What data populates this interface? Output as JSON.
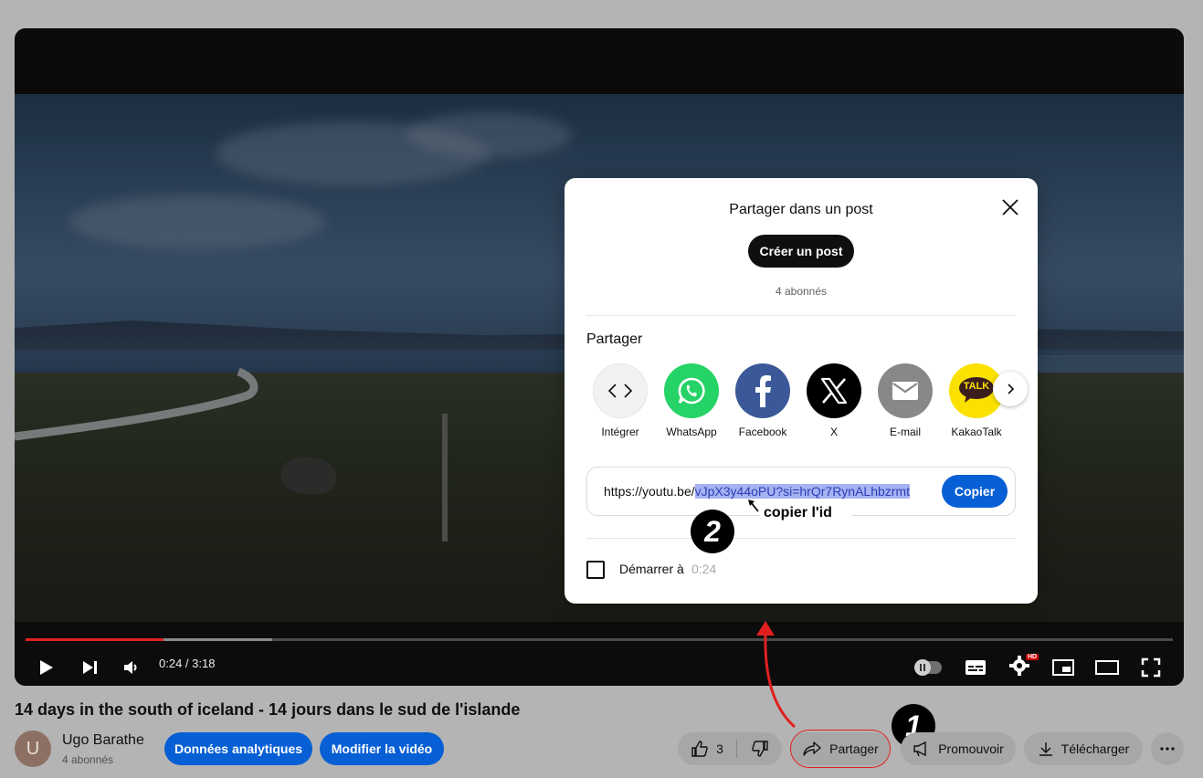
{
  "player": {
    "time_display": "0:24 / 3:18",
    "progress_played": 0.12,
    "progress_buffered": 0.215,
    "hd_badge": "HD"
  },
  "share_dialog": {
    "post_title": "Partager dans un post",
    "create_post_label": "Créer un post",
    "subscribers": "4 abonnés",
    "share_heading": "Partager",
    "targets": [
      {
        "label": "Intégrer",
        "icon": "embed-icon",
        "color": "#f2f2f2"
      },
      {
        "label": "WhatsApp",
        "icon": "whatsapp-icon",
        "color": "#25d366"
      },
      {
        "label": "Facebook",
        "icon": "facebook-icon",
        "color": "#3b5998"
      },
      {
        "label": "X",
        "icon": "x-icon",
        "color": "#000000"
      },
      {
        "label": "E-mail",
        "icon": "email-icon",
        "color": "#888888"
      },
      {
        "label": "KakaoTalk",
        "icon": "kakaotalk-icon",
        "color": "#fae100",
        "icon_text": "TALK"
      }
    ],
    "link_prefix": "https://youtu.be/",
    "link_selected": "vJpX3y44oPU?si=hrQr7RynALhbzrmt",
    "copy_label": "Copier",
    "start_at_label": "Démarrer à",
    "start_at_time": "0:24"
  },
  "annotations": {
    "copy_id_note": "copier l'id",
    "step_1": "1",
    "step_2": "2",
    "arrow_color": "#e02020"
  },
  "video": {
    "title": "14 days in the south of iceland - 14 jours dans le sud de l'islande",
    "channel_initial": "U",
    "channel_name": "Ugo Barathe",
    "channel_subscribers": "4 abonnés",
    "analytics_label": "Données analytiques",
    "edit_label": "Modifier la vidéo",
    "like_count": "3",
    "share_label": "Partager",
    "promote_label": "Promouvoir",
    "download_label": "Télécharger"
  },
  "colors": {
    "accent_blue": "#065fd4",
    "progress_red": "#e02020",
    "page_background": "#b4b4b4"
  }
}
